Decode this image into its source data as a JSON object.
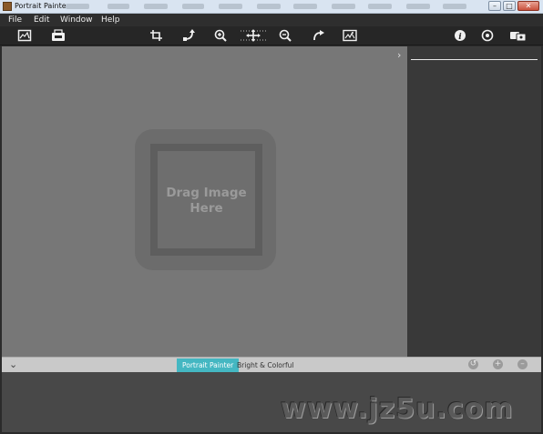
{
  "window": {
    "title": "Portrait Painter",
    "minimize_glyph": "–",
    "maximize_glyph": "□",
    "close_glyph": "✕"
  },
  "menu": [
    "File",
    "Edit",
    "Window",
    "Help"
  ],
  "toolbar": {
    "left_tools": [
      "open-image-icon",
      "save-image-icon"
    ],
    "center_tools": [
      "crop-icon",
      "rotate-left-icon",
      "zoom-in-icon",
      "move-icon",
      "zoom-out-icon",
      "rotate-right-icon",
      "compare-icon"
    ],
    "right_tools": [
      "info-icon",
      "settings-icon",
      "share-icon"
    ]
  },
  "canvas": {
    "drop_hint_line1": "Drag Image",
    "drop_hint_line2": "Here",
    "collapse_glyph": "›"
  },
  "presets": {
    "collapse_glyph": "⌄",
    "tabs": [
      {
        "label": "Portrait Painter",
        "active": true
      },
      {
        "label": "Bright & Colorful",
        "active": false
      }
    ],
    "controls": [
      "reset-icon",
      "add-icon",
      "remove-icon"
    ]
  },
  "watermark": "www.jz5u.com",
  "colors": {
    "accent": "#44b7c2",
    "canvas_bg": "#777777",
    "panel_bg": "#393939"
  }
}
